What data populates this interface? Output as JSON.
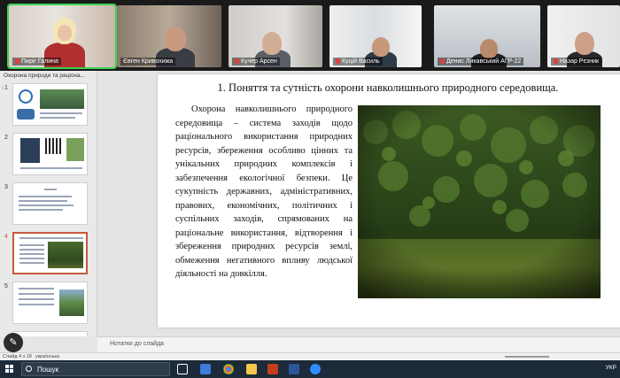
{
  "participants": [
    {
      "name": "Пиріг Галина",
      "muted": true
    },
    {
      "name": "Євген Кривохижа",
      "muted": false
    },
    {
      "name": "Кучер Арсен",
      "muted": true
    },
    {
      "name": "Куцій Василь",
      "muted": true
    },
    {
      "name": "Денис Ликавський АГР-22",
      "muted": true
    },
    {
      "name": "Назар Рєзник",
      "muted": true
    }
  ],
  "thumbnails": {
    "title": "Охорона природи та раціона...",
    "items": [
      {
        "number": "1"
      },
      {
        "number": "2"
      },
      {
        "number": "3"
      },
      {
        "number": "4",
        "selected": true
      },
      {
        "number": "5"
      }
    ]
  },
  "slide": {
    "title": "1. Поняття та сутність охорони навколишнього природного середовища.",
    "body": "Охорона навколишнього природного середовища – система заходів щодо раціонального використання природних ресурсів, збереження особливо цінних та унікальних природних комплексів і забезпечення екологічної безпеки. Це сукупність державних, адміністративних, правових, економічних, політичних і суспільних заходів, спрямованих на раціональне використання, відтворення і збереження природних ресурсів землі, обмеження негативного впливу людської діяльності на довкілля."
  },
  "notes_placeholder": "Нотатки до слайда",
  "status": {
    "slide_info": "Слайд 4 з 18",
    "language": "українська"
  },
  "taskbar": {
    "search_label": "Пошук",
    "tray_lang": "УКР"
  },
  "colors": {
    "selected_border": "#c55a3b",
    "active_speaker": "#39d353"
  }
}
